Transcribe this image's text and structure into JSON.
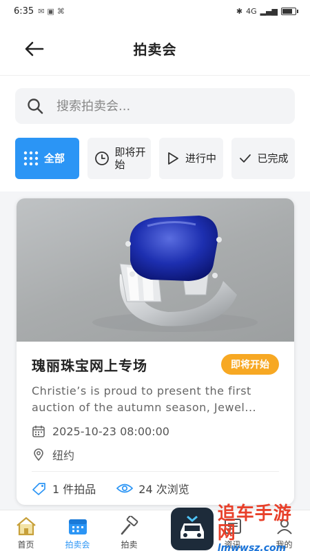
{
  "status_bar": {
    "time": "6:35",
    "network": "4G",
    "battery": "battery-icon"
  },
  "header": {
    "title": "拍卖会",
    "back_icon": "back-arrow-icon"
  },
  "search": {
    "placeholder": "搜索拍卖会..."
  },
  "filters": [
    {
      "label": "全部",
      "icon": "grid-icon",
      "active": true
    },
    {
      "label": "即将开始",
      "icon": "clock-icon",
      "active": false
    },
    {
      "label": "进行中",
      "icon": "play-icon",
      "active": false
    },
    {
      "label": "已完成",
      "icon": "check-icon",
      "active": false
    }
  ],
  "card": {
    "title": "瑰丽珠宝网上专场",
    "badge": "即将开始",
    "description": "Christie’s is proud to present the first auction of the autumn season, Jewel...",
    "datetime": "2025-10-23 08:00:00",
    "location": "纽约",
    "lots": "1 件拍品",
    "views": "24 次浏览",
    "colors": {
      "badge": "#f7a823",
      "accent": "#2b95f5"
    }
  },
  "tabbar": [
    {
      "label": "首页",
      "icon": "home-icon",
      "active": false
    },
    {
      "label": "拍卖会",
      "icon": "calendar-icon",
      "active": true
    },
    {
      "label": "拍卖",
      "icon": "hammer-icon",
      "active": false
    },
    {
      "label": "",
      "icon": "grid-icon",
      "active": false
    },
    {
      "label": "资讯",
      "icon": "news-icon",
      "active": false
    },
    {
      "label": "我的",
      "icon": "user-icon",
      "active": false
    }
  ],
  "watermark": {
    "cn": "追车手游网",
    "url": "lmwwsz.com"
  }
}
